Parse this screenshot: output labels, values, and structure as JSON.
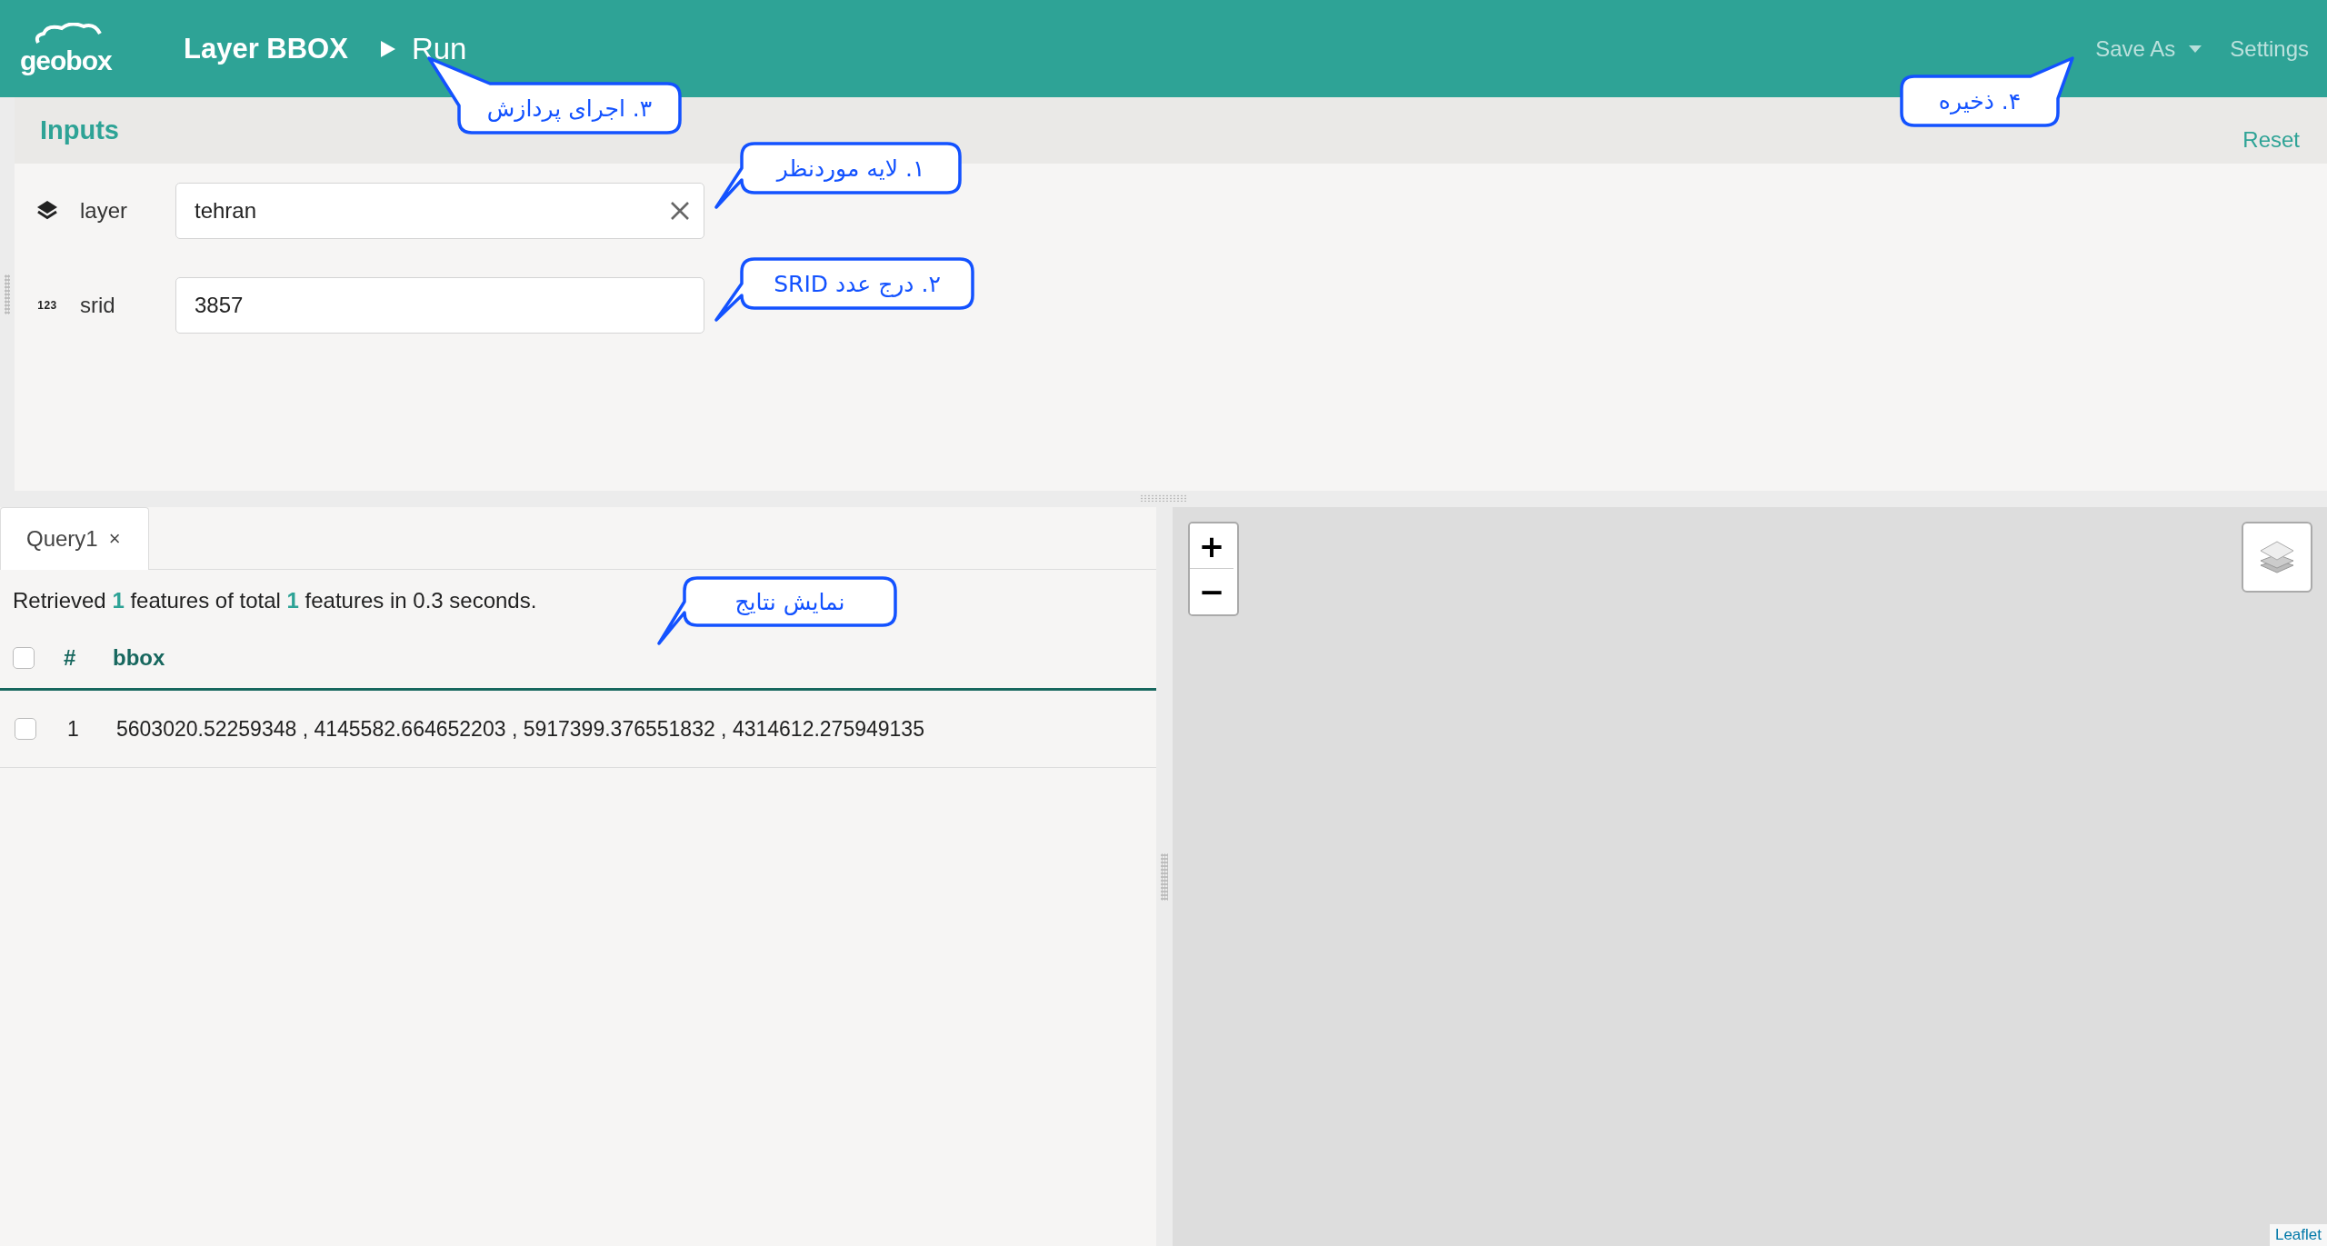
{
  "header": {
    "logo": "geobox",
    "title": "Layer BBOX",
    "run_label": "Run",
    "menu": [
      {
        "label": "Save As",
        "kind": "dropdown"
      },
      {
        "label": "Settings",
        "kind": "link"
      }
    ]
  },
  "inputs": {
    "title": "Inputs",
    "reset": "Reset",
    "fields": [
      {
        "kind": "layer",
        "label": "layer",
        "value": "tehran",
        "clearable": true
      },
      {
        "kind": "number",
        "icon_text": "123",
        "label": "srid",
        "value": "3857",
        "clearable": false
      }
    ]
  },
  "results": {
    "tabs": [
      {
        "label": "Query1",
        "close": "×",
        "selected": true
      }
    ],
    "summary": "Retrieved **1** features of total **1** features in 0.3 seconds.",
    "table": {
      "all_checked": false,
      "columns": [
        "#",
        "bbox"
      ],
      "rows": [
        {
          "checked": false,
          "cells": [
            "1",
            "5603020.52259348 , 4145582.664652203 , 5917399.376551832 , 4314612.275949135"
          ]
        }
      ]
    }
  },
  "map": {
    "zoom_in": "+",
    "zoom_out": "−",
    "attribution": "Leaflet"
  },
  "callouts": [
    {
      "text": "۴. ذخیره"
    },
    {
      "text": "۳. اجرای پردازش"
    },
    {
      "text": "۱. لایه موردنظر"
    },
    {
      "text": "۲. درج عدد SRID"
    },
    {
      "text": "نمایش نتایج"
    }
  ]
}
